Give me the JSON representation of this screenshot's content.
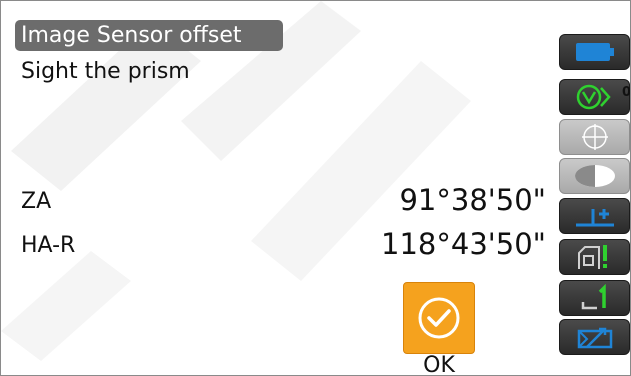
{
  "title": "Image Sensor offset",
  "instruction": "Sight the prism",
  "measurements": [
    {
      "label": "ZA",
      "value": "91°38'50\""
    },
    {
      "label": "HA-R",
      "value": "118°43'50\""
    }
  ],
  "ok_button": {
    "label": "OK",
    "icon": "check-circle-icon"
  },
  "status": {
    "prism_constant": "0",
    "icons": [
      "battery-icon",
      "prism-target-icon",
      "crosshair-icon",
      "half-circle-icon",
      "tilt-correction-icon",
      "laser-plummet-icon",
      "edm-mode-icon",
      "input-panel-icon"
    ]
  },
  "colors": {
    "accent": "#f5a21e",
    "status_green": "#2fd12f",
    "status_blue": "#1f84d6"
  }
}
